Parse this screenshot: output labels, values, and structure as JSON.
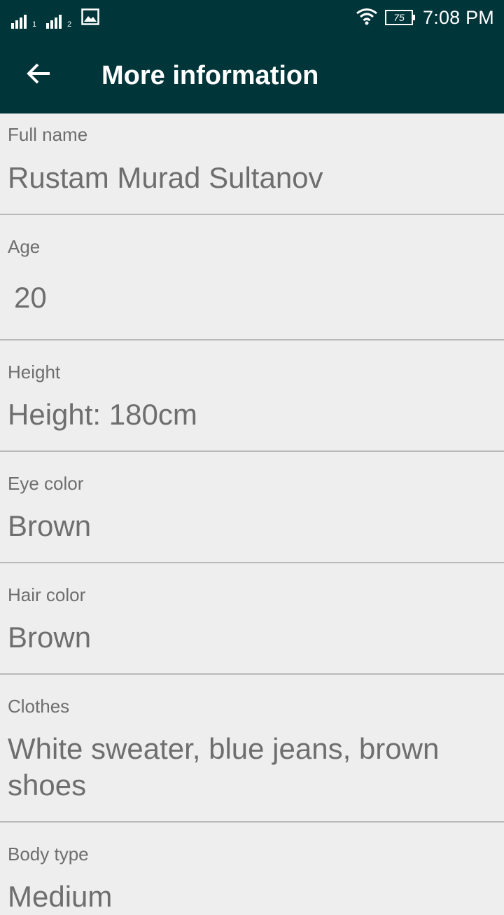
{
  "status_bar": {
    "time": "7:08 PM",
    "battery_level": "75",
    "sim1_index": "1",
    "sim2_index": "2",
    "icons": [
      "signal-sim1-icon",
      "signal-sim2-icon",
      "image-notification-icon",
      "wifi-icon",
      "battery-icon"
    ]
  },
  "toolbar": {
    "title": "More information",
    "back_icon": "arrow-back-icon"
  },
  "fields": [
    {
      "label": "Full name",
      "value": "Rustam Murad Sultanov"
    },
    {
      "label": "Age",
      "value": "20"
    },
    {
      "label": "Height",
      "value": "Height: 180cm"
    },
    {
      "label": "Eye color",
      "value": "Brown"
    },
    {
      "label": "Hair color",
      "value": "Brown"
    },
    {
      "label": "Clothes",
      "value": "White sweater, blue jeans, brown shoes"
    },
    {
      "label": "Body type",
      "value": "Medium"
    }
  ],
  "colors": {
    "header_bg": "#00353a",
    "page_bg": "#eeeeee",
    "text": "#6e6e6e",
    "divider": "#b9b9b9"
  }
}
